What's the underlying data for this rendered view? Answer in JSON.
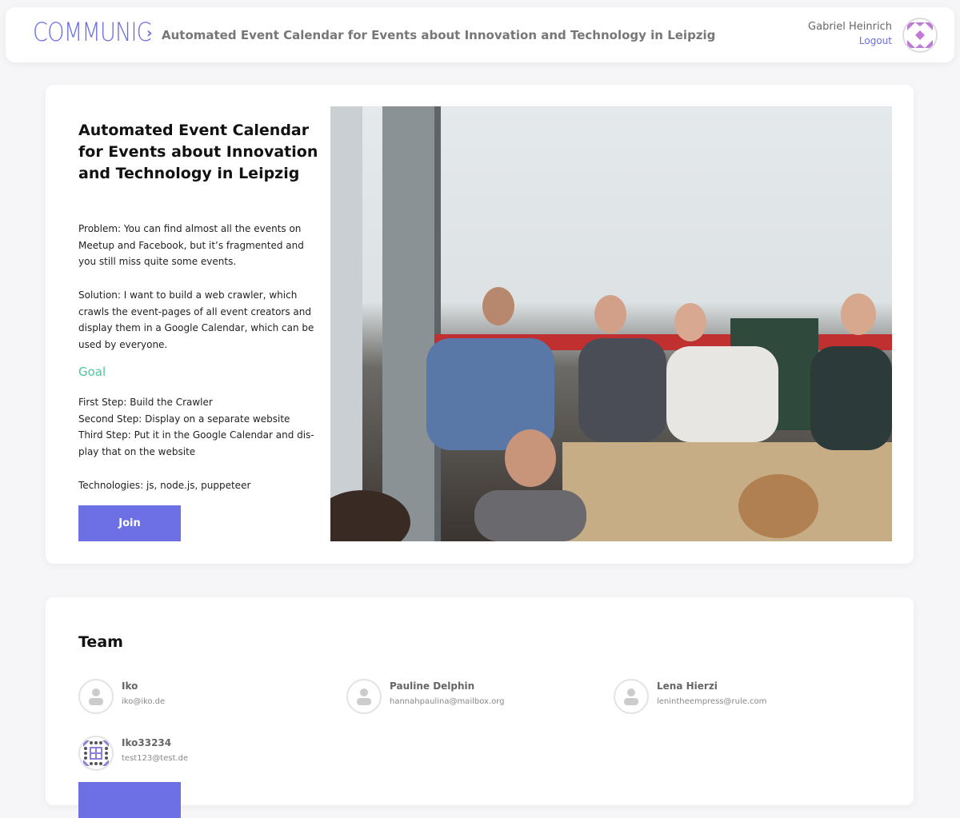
{
  "header": {
    "logo": "COMMUNIC",
    "breadcrumb": "Automated Event Calendar for Events about Innovation and Technology in Leipzig",
    "user_name": "Gabriel Heinrich",
    "logout": "Logout"
  },
  "project": {
    "title": "Automated Event Calendar for Events about Innovation and Technology in Leipzig",
    "problem": "Problem: You can find almost all the events on Meetup and Facebook, but it’s fragmented and you still miss quite some events.",
    "solution": "Solution: I want to build a web crawler, which crawls the event-pages of all event creators and display them in a Google Calendar, which can be used by everyone.",
    "goal_heading": "Goal",
    "steps": [
      "First Step: Build the Crawler",
      "Second Step: Display on a separate website",
      "Third Step: Put it in the Google Calendar and dis-play that on the website"
    ],
    "technologies": "Technologies: js, node.js, puppeteer",
    "join": "Join"
  },
  "team": {
    "title": "Team",
    "members": [
      {
        "name": "Iko",
        "email": "iko@iko.de"
      },
      {
        "name": "Pauline Delphin",
        "email": "hannahpaulina@mailbox.org"
      },
      {
        "name": "Lena Hierzi",
        "email": "lenintheempress@rule.com"
      },
      {
        "name": "Iko33234",
        "email": "test123@test.de"
      }
    ]
  },
  "colors": {
    "accent": "#6c70e2",
    "goal": "#4fc4a0"
  }
}
